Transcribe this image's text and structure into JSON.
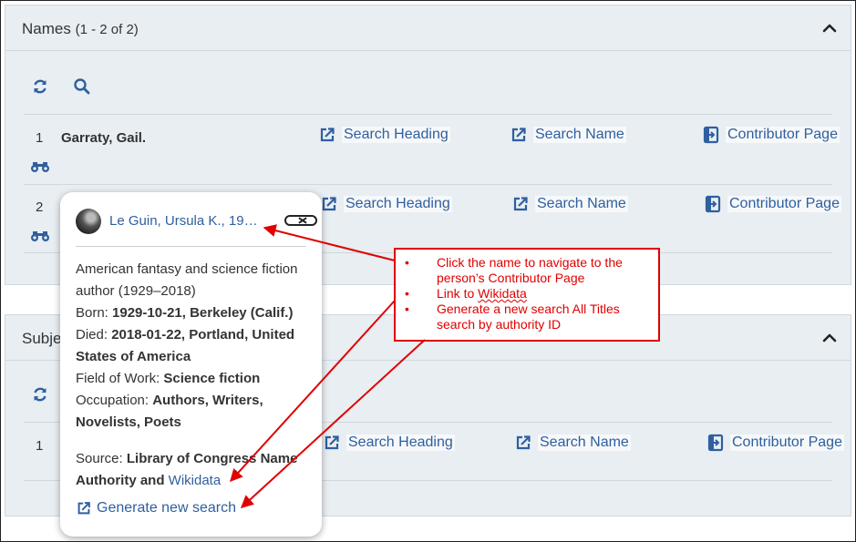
{
  "names_panel": {
    "title": "Names",
    "count": "(1 - 2 of 2)",
    "rows": [
      {
        "num": "1",
        "name": "Garraty, Gail.",
        "search_heading": "Search Heading",
        "search_name": "Search Name",
        "contributor_page": "Contributor Page"
      },
      {
        "num": "2",
        "search_heading": "Search Heading",
        "search_name": "Search Name",
        "contributor_page": "Contributor Page"
      }
    ]
  },
  "subjects_panel": {
    "title": "Subje",
    "rows": [
      {
        "num": "1",
        "search_heading": "Search Heading",
        "search_name": "Search Name",
        "contributor_page": "Contributor Page"
      }
    ]
  },
  "popup": {
    "name": "Le Guin, Ursula K., 19…",
    "description": "American fantasy and science fiction author (1929–2018)",
    "born_label": "Born: ",
    "born_value": "1929-10-21, Berkeley (Calif.)",
    "died_label": "Died: ",
    "died_value": "2018-01-22, Portland, United States of America",
    "field_label": "Field of Work: ",
    "field_value": "Science fiction",
    "occupation_label": "Occupation: ",
    "occupation_value": "Authors, Writers, Novelists, Poets",
    "source_label": "Source: ",
    "source_value": "Library of Congress Name Authority and ",
    "wikidata_link": "Wikidata",
    "generate_search": "Generate new search"
  },
  "annotation": {
    "item1": "Click the name to navigate to the person’s Contributor Page",
    "item2_prefix": "Link to ",
    "item2_link": "Wikidata",
    "item3": "Generate a new search All Titles search by authority ID"
  },
  "colors": {
    "link": "#2f5f9e",
    "panel_bg": "#e8eef2",
    "annotation": "#e00000"
  },
  "icons": [
    "refresh-icon",
    "search-icon",
    "chevron-up-icon",
    "binoculars-icon",
    "external-link-icon",
    "contributor-page-icon",
    "close-icon"
  ]
}
